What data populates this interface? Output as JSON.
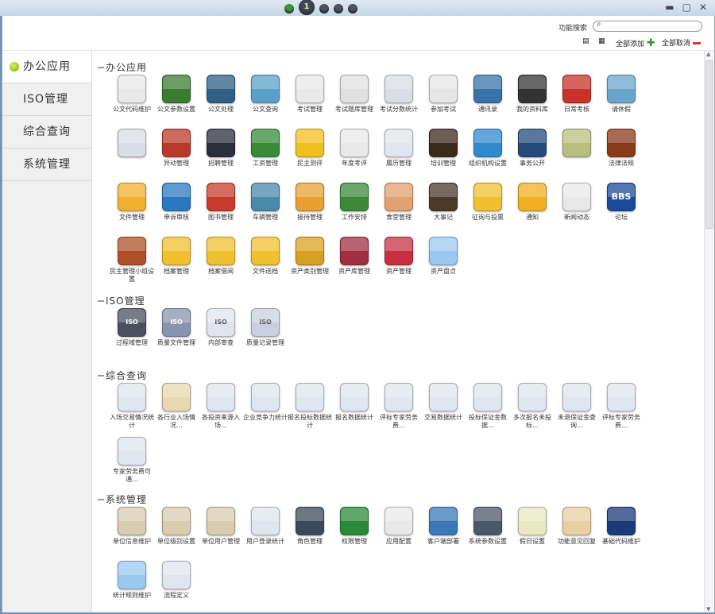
{
  "topbar": {
    "active_page": "1"
  },
  "toolbar": {
    "search_label": "功能搜索",
    "add_all": "全部添加",
    "cancel_all": "全部取消"
  },
  "nav": [
    "办公应用",
    "ISO管理",
    "综合查询",
    "系统管理"
  ],
  "sections": [
    {
      "title": "办公应用",
      "rows": [
        [
          {
            "l": "公文代码维护",
            "c": "#e8e8e8"
          },
          {
            "l": "公文参数设置",
            "c": "#3d7a33"
          },
          {
            "l": "公文处理",
            "c": "#2f5f84"
          },
          {
            "l": "公文查询",
            "c": "#5aa0c8"
          },
          {
            "l": "考试管理",
            "c": "#e9e9e9"
          },
          {
            "l": "考试题库管理",
            "c": "#e0e0e0"
          },
          {
            "l": "考试分数统计",
            "c": "#d9dee6"
          },
          {
            "l": "参加考试",
            "c": "#e6e6e6"
          },
          {
            "l": "通讯录",
            "c": "#3772a8"
          },
          {
            "l": "我的资料库",
            "c": "#333333"
          },
          {
            "l": "日常考核",
            "c": "#c8322a"
          },
          {
            "l": "请休假",
            "c": "#6aa6cc"
          }
        ],
        [
          {
            "l": "",
            "c": "#d8dde6"
          },
          {
            "l": "异动管理",
            "c": "#b83a2a"
          },
          {
            "l": "招聘管理",
            "c": "#2a2f3a"
          },
          {
            "l": "工资管理",
            "c": "#3a8a3a"
          },
          {
            "l": "民主测评",
            "c": "#f0c020"
          },
          {
            "l": "年度考评",
            "c": "#e8e8e8"
          },
          {
            "l": "履历管理",
            "c": "#dfe6ef"
          },
          {
            "l": "培训管理",
            "c": "#3a2a1a"
          },
          {
            "l": "组织机构设置",
            "c": "#2f8ad0"
          },
          {
            "l": "事务公开",
            "c": "#244a7a"
          },
          {
            "l": "",
            "c": "#b8c080"
          },
          {
            "l": "法律法规",
            "c": "#8a3a1a"
          }
        ],
        [
          {
            "l": "文件管理",
            "c": "#f0b030"
          },
          {
            "l": "申诉审核",
            "c": "#2a78c0"
          },
          {
            "l": "图书管理",
            "c": "#c83a2a"
          },
          {
            "l": "车辆管理",
            "c": "#4a8aa8"
          },
          {
            "l": "接待管理",
            "c": "#e8a030"
          },
          {
            "l": "工作安排",
            "c": "#3a8a3a"
          },
          {
            "l": "食堂管理",
            "c": "#e0a070"
          },
          {
            "l": "大事记",
            "c": "#4a3a2a"
          },
          {
            "l": "征询与投票",
            "c": "#f0c030"
          },
          {
            "l": "通知",
            "c": "#f0b020"
          },
          {
            "l": "新闻动态",
            "c": "#e8e8e8"
          },
          {
            "l": "论坛",
            "c": "#1a4a9a"
          }
        ],
        [
          {
            "l": "民主管理小组设置",
            "c": "#b0502a"
          },
          {
            "l": "档案管理",
            "c": "#f0c030"
          },
          {
            "l": "档案借阅",
            "c": "#f0c030"
          },
          {
            "l": "文件送档",
            "c": "#f0c030"
          },
          {
            "l": "资产类别管理",
            "c": "#d8a020"
          },
          {
            "l": "资产库管理",
            "c": "#a03040"
          },
          {
            "l": "资产管理",
            "c": "#c83040"
          },
          {
            "l": "资产盘点",
            "c": "#9ac8f0"
          }
        ]
      ]
    },
    {
      "title": "ISO管理",
      "rows": [
        [
          {
            "l": "过程域管理",
            "c": "#4a5060"
          },
          {
            "l": "质量文件管理",
            "c": "#8a94b0"
          },
          {
            "l": "内部审查",
            "c": "#e0e4ec"
          },
          {
            "l": "质量记录管理",
            "c": "#c8d0e0"
          }
        ]
      ]
    },
    {
      "title": "综合查询",
      "rows": [
        [
          {
            "l": "入场交易情况统计",
            "c": "#dfe6ef"
          },
          {
            "l": "各行业入场情况…",
            "c": "#e8d8b0"
          },
          {
            "l": "各投资来源入场…",
            "c": "#dfe6ef"
          },
          {
            "l": "企业竞争力统计",
            "c": "#dfe6ef"
          },
          {
            "l": "报名投标数据统计",
            "c": "#dfe6ef"
          },
          {
            "l": "报名数据统计",
            "c": "#dfe6ef"
          },
          {
            "l": "评标专家劳务费…",
            "c": "#dfe6ef"
          },
          {
            "l": "交易数据统计",
            "c": "#dfe6ef"
          },
          {
            "l": "投标保证金数据…",
            "c": "#dfe6ef"
          },
          {
            "l": "多次报名未投标…",
            "c": "#dfe6ef"
          },
          {
            "l": "未退保证金查询…",
            "c": "#dfe6ef"
          },
          {
            "l": "评标专家劳务费…",
            "c": "#dfe6ef"
          }
        ],
        [
          {
            "l": "专家劳务费可通…",
            "c": "#dfe6ef"
          }
        ]
      ]
    },
    {
      "title": "系统管理",
      "rows": [
        [
          {
            "l": "单位信息维护",
            "c": "#d8ccb0"
          },
          {
            "l": "单位级别设置",
            "c": "#d8ccb0"
          },
          {
            "l": "单位用户管理",
            "c": "#d8ccb0"
          },
          {
            "l": "用户登录统计",
            "c": "#dfe6ef"
          },
          {
            "l": "角色管理",
            "c": "#3a4a5a"
          },
          {
            "l": "权限管理",
            "c": "#2a8a3a"
          },
          {
            "l": "应用配置",
            "c": "#e8e8e8"
          },
          {
            "l": "客户端部署",
            "c": "#3a78b8"
          },
          {
            "l": "系统参数设置",
            "c": "#4a5868"
          },
          {
            "l": "假日设置",
            "c": "#e8e8c0"
          },
          {
            "l": "功能意见回复",
            "c": "#e8d0a0"
          },
          {
            "l": "基础代码维护",
            "c": "#1a3a7a"
          }
        ],
        [
          {
            "l": "统计规则维护",
            "c": "#9ac8f0"
          },
          {
            "l": "流程定义",
            "c": "#e0e4ec"
          }
        ]
      ]
    }
  ],
  "icon_texts": {
    "BBS": "BBS",
    "ISO": "ISO"
  }
}
